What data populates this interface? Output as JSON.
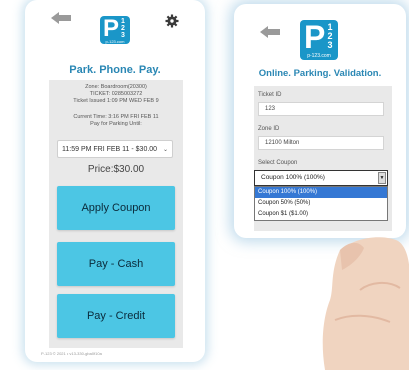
{
  "left_phone": {
    "tagline": "Park. Phone. Pay.",
    "logo": {
      "letter": "P",
      "numerals": [
        "1",
        "2",
        "3"
      ],
      "domain": "p-123.com"
    },
    "zone_line": "Zone: Boardroom(20300)",
    "ticket_line": "TICKET: 0285003272",
    "issued_line": "Ticket Issued 1:09 PM WED FEB 9",
    "current_time_line": "Current Time: 3:16 PM FRI FEB 11",
    "pay_for_line": "Pay for Parking Until:",
    "selected_time": "11:59 PM FRI FEB 11 - $30.00",
    "price": "Price:$30.00",
    "buttons": {
      "apply_coupon": "Apply Coupon",
      "pay_cash": "Pay - Cash",
      "pay_credit": "Pay - Credit"
    },
    "footer": "P-123 © 2021 • v13-330-gba0f10a"
  },
  "right_phone": {
    "tagline": "Online. Parking. Validation.",
    "logo": {
      "letter": "P",
      "numerals": [
        "1",
        "2",
        "3"
      ],
      "domain": "p-123.com"
    },
    "ticket_id_label": "Ticket ID",
    "ticket_id_value": "123",
    "zone_id_label": "Zone ID",
    "zone_id_value": "12100 Milton",
    "select_coupon_label": "Select Coupon",
    "selected_coupon": "Coupon 100% (100%)",
    "coupon_options": [
      "Coupon 100% (100%)",
      "Coupon 50% (50%)",
      "Coupon $1 ($1.00)"
    ]
  },
  "colors": {
    "brand_blue": "#1a96c8",
    "tagline_blue": "#2a87b4",
    "button_cyan": "#4cc6e4",
    "selected_option": "#3578d4"
  },
  "icons": [
    "back-arrow-icon",
    "gear-icon",
    "dropdown-chevron-icon"
  ]
}
